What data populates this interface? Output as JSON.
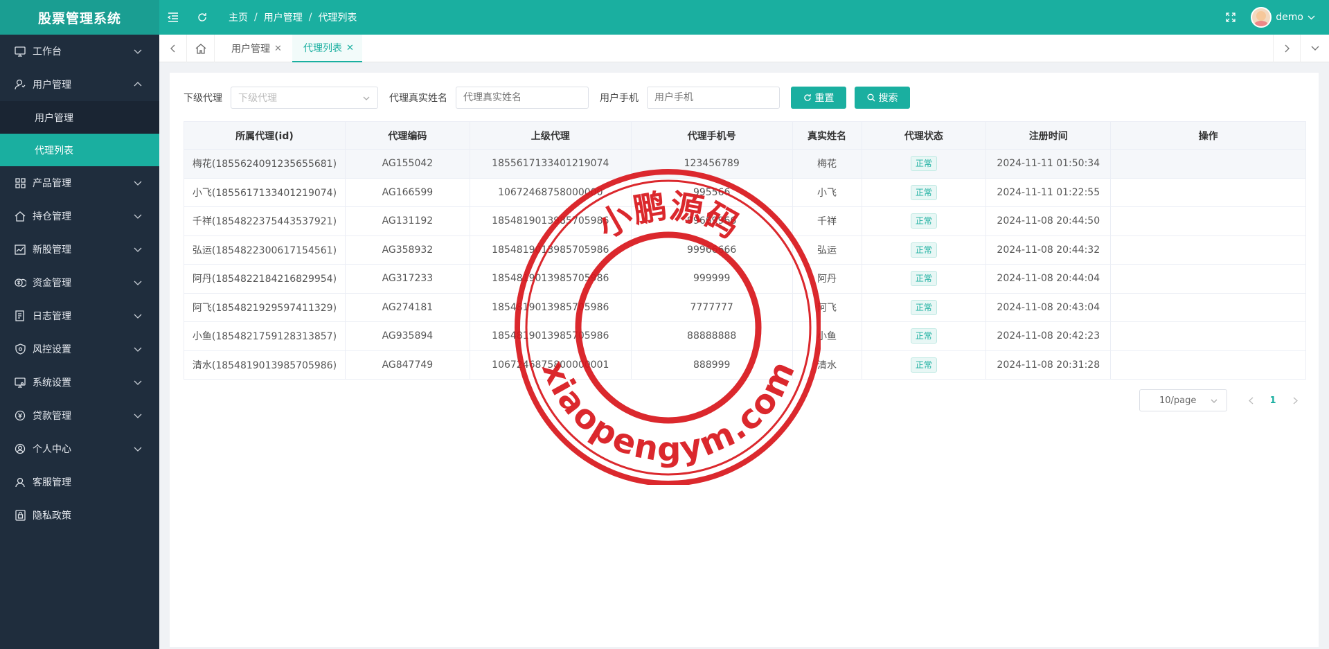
{
  "app": {
    "title": "股票管理系统"
  },
  "header": {
    "breadcrumb": [
      "主页",
      "用户管理",
      "代理列表"
    ],
    "user_name": "demo"
  },
  "sidebar": {
    "items": [
      {
        "label": "工作台",
        "icon": "monitor-icon",
        "has_children": true,
        "expanded": false
      },
      {
        "label": "用户管理",
        "icon": "users-icon",
        "has_children": true,
        "expanded": true,
        "children": [
          {
            "label": "用户管理",
            "active": false
          },
          {
            "label": "代理列表",
            "active": true
          }
        ]
      },
      {
        "label": "产品管理",
        "icon": "grid-icon",
        "has_children": true,
        "expanded": false
      },
      {
        "label": "持仓管理",
        "icon": "home-icon",
        "has_children": true,
        "expanded": false
      },
      {
        "label": "新股管理",
        "icon": "chart-icon",
        "has_children": true,
        "expanded": false
      },
      {
        "label": "资金管理",
        "icon": "money-icon",
        "has_children": true,
        "expanded": false
      },
      {
        "label": "日志管理",
        "icon": "log-icon",
        "has_children": true,
        "expanded": false
      },
      {
        "label": "风控设置",
        "icon": "shield-icon",
        "has_children": true,
        "expanded": false
      },
      {
        "label": "系统设置",
        "icon": "settings-icon",
        "has_children": true,
        "expanded": false
      },
      {
        "label": "贷款管理",
        "icon": "loan-icon",
        "has_children": true,
        "expanded": false
      },
      {
        "label": "个人中心",
        "icon": "user-circle-icon",
        "has_children": true,
        "expanded": false
      },
      {
        "label": "客服管理",
        "icon": "headset-icon",
        "has_children": false,
        "expanded": false
      },
      {
        "label": "隐私政策",
        "icon": "privacy-icon",
        "has_children": false,
        "expanded": false
      }
    ]
  },
  "tabs": [
    {
      "label": "用户管理",
      "active": false
    },
    {
      "label": "代理列表",
      "active": true
    }
  ],
  "filters": {
    "sub_agent_label": "下级代理",
    "sub_agent_placeholder": "下级代理",
    "real_name_label": "代理真实姓名",
    "real_name_placeholder": "代理真实姓名",
    "phone_label": "用户手机",
    "phone_placeholder": "用户手机",
    "reset_label": "重置",
    "search_label": "搜索"
  },
  "table": {
    "columns": [
      "所属代理(id)",
      "代理编码",
      "上级代理",
      "代理手机号",
      "真实姓名",
      "代理状态",
      "注册时间",
      "操作"
    ],
    "rows": [
      [
        "梅花(1855624091235655681)",
        "AG155042",
        "1855617133401219074",
        "123456789",
        "梅花",
        "正常",
        "2024-11-11 01:50:34",
        ""
      ],
      [
        "小飞(1855617133401219074)",
        "AG166599",
        "10672468758000000",
        "995566",
        "小飞",
        "正常",
        "2024-11-11 01:22:55",
        ""
      ],
      [
        "千祥(1854822375443537921)",
        "AG131192",
        "1854819013985705986",
        "99669966",
        "千祥",
        "正常",
        "2024-11-08 20:44:50",
        ""
      ],
      [
        "弘运(1854822300617154561)",
        "AG358932",
        "1854819013985705986",
        "99966666",
        "弘运",
        "正常",
        "2024-11-08 20:44:32",
        ""
      ],
      [
        "阿丹(1854822184216829954)",
        "AG317233",
        "1854819013985705986",
        "999999",
        "阿丹",
        "正常",
        "2024-11-08 20:44:04",
        ""
      ],
      [
        "阿飞(1854821929597411329)",
        "AG274181",
        "1854819013985705986",
        "7777777",
        "阿飞",
        "正常",
        "2024-11-08 20:43:04",
        ""
      ],
      [
        "小鱼(1854821759128313857)",
        "AG935894",
        "1854819013985705986",
        "88888888",
        "小鱼",
        "正常",
        "2024-11-08 20:42:23",
        ""
      ],
      [
        "清水(1854819013985705986)",
        "AG847749",
        "1067246875800000001",
        "888999",
        "清水",
        "正常",
        "2024-11-08 20:31:28",
        ""
      ]
    ]
  },
  "pagination": {
    "page_size": "10/page",
    "current_page": "1"
  },
  "watermark": {
    "top_text": "小鹏源码",
    "bottom_text": "xiaopengym.com"
  },
  "colors": {
    "primary": "#1aafa0",
    "sidebar_bg": "#1f2d3d",
    "stamp": "#d9161c"
  }
}
